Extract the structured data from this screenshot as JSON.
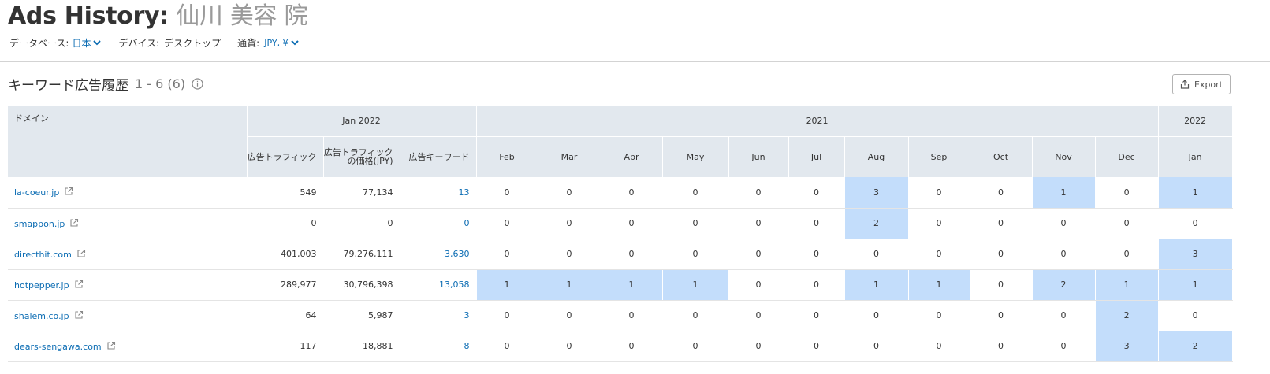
{
  "header": {
    "title_main": "Ads History:",
    "title_sub": "仙川 美容 院"
  },
  "filters": [
    {
      "label": "データベース:",
      "value": "日本",
      "dropdown": true
    },
    {
      "label": "デバイス:",
      "value": "デスクトップ",
      "dropdown": false
    },
    {
      "label": "通貨:",
      "value": "JPY, ¥",
      "dropdown": true
    }
  ],
  "section": {
    "title": "キーワード広告履歴",
    "count": "1 - 6 (6)",
    "export_label": "Export"
  },
  "table": {
    "domain_header": "ドメイン",
    "group_jan2022": "Jan 2022",
    "group_2021": "2021",
    "group_2022": "2022",
    "col_traffic": "広告トラフィック",
    "col_traffic_price": "広告トラフィックの価格(JPY)",
    "col_keywords": "広告キーワード",
    "months": [
      "Feb",
      "Mar",
      "Apr",
      "May",
      "Jun",
      "Jul",
      "Aug",
      "Sep",
      "Oct",
      "Nov",
      "Dec",
      "Jan"
    ],
    "rows": [
      {
        "domain": "la-coeur.jp",
        "traffic": "549",
        "price": "77,134",
        "keywords": "13",
        "monthly": [
          "0",
          "0",
          "0",
          "0",
          "0",
          "0",
          "3",
          "0",
          "0",
          "1",
          "0",
          "1"
        ],
        "highlight": [
          false,
          false,
          false,
          false,
          false,
          false,
          true,
          false,
          false,
          true,
          false,
          true
        ]
      },
      {
        "domain": "smappon.jp",
        "traffic": "0",
        "price": "0",
        "keywords": "0",
        "monthly": [
          "0",
          "0",
          "0",
          "0",
          "0",
          "0",
          "2",
          "0",
          "0",
          "0",
          "0",
          "0"
        ],
        "highlight": [
          false,
          false,
          false,
          false,
          false,
          false,
          true,
          false,
          false,
          false,
          false,
          false
        ]
      },
      {
        "domain": "directhit.com",
        "traffic": "401,003",
        "price": "79,276,111",
        "keywords": "3,630",
        "monthly": [
          "0",
          "0",
          "0",
          "0",
          "0",
          "0",
          "0",
          "0",
          "0",
          "0",
          "0",
          "3"
        ],
        "highlight": [
          false,
          false,
          false,
          false,
          false,
          false,
          false,
          false,
          false,
          false,
          false,
          true
        ]
      },
      {
        "domain": "hotpepper.jp",
        "traffic": "289,977",
        "price": "30,796,398",
        "keywords": "13,058",
        "monthly": [
          "1",
          "1",
          "1",
          "1",
          "0",
          "0",
          "1",
          "1",
          "0",
          "2",
          "1",
          "1"
        ],
        "highlight": [
          true,
          true,
          true,
          true,
          false,
          false,
          true,
          true,
          false,
          true,
          true,
          true
        ]
      },
      {
        "domain": "shalem.co.jp",
        "traffic": "64",
        "price": "5,987",
        "keywords": "3",
        "monthly": [
          "0",
          "0",
          "0",
          "0",
          "0",
          "0",
          "0",
          "0",
          "0",
          "0",
          "2",
          "0"
        ],
        "highlight": [
          false,
          false,
          false,
          false,
          false,
          false,
          false,
          false,
          false,
          false,
          true,
          false
        ]
      },
      {
        "domain": "dears-sengawa.com",
        "traffic": "117",
        "price": "18,881",
        "keywords": "8",
        "monthly": [
          "0",
          "0",
          "0",
          "0",
          "0",
          "0",
          "0",
          "0",
          "0",
          "0",
          "3",
          "2"
        ],
        "highlight": [
          false,
          false,
          false,
          false,
          false,
          false,
          false,
          false,
          false,
          false,
          true,
          true
        ]
      }
    ]
  },
  "colors": {
    "link": "#0b6cb3",
    "header_bg": "#e2e8ee",
    "highlight": "#c3ddfb",
    "divider": "#4a8cc8"
  }
}
